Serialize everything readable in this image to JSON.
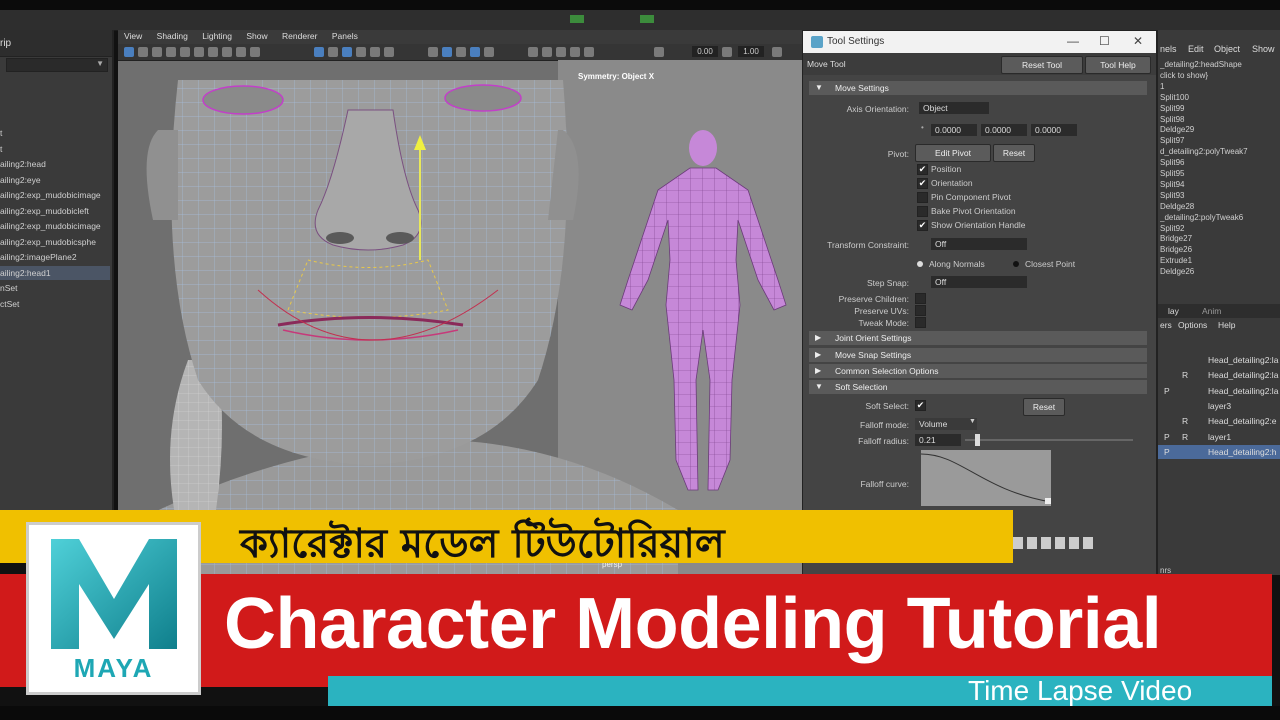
{
  "viewport": {
    "menu": [
      "View",
      "Shading",
      "Lighting",
      "Show",
      "Renderer",
      "Panels"
    ],
    "field_a": "0.00",
    "field_b": "1.00",
    "symmetry_label": "Symmetry: Object X",
    "camera_label": "persp"
  },
  "outliner": {
    "top_label": "rip",
    "items": [
      "t",
      "t",
      "ailing2:head",
      "ailing2:eye",
      "ailing2:exp_mudobicimage",
      "ailing2:exp_mudobicleft",
      "ailing2:exp_mudobicimage",
      "ailing2:exp_mudobicsphe",
      "ailing2:imagePlane2",
      "ailing2:head1",
      "nSet",
      "ctSet"
    ],
    "selected_index": 9
  },
  "tool_settings": {
    "window_title": "Tool Settings",
    "window_buttons": [
      "—",
      "☐",
      "✕"
    ],
    "tool_name": "Move Tool",
    "reset_tool": "Reset Tool",
    "tool_help": "Tool Help",
    "sections": {
      "move_settings": "Move Settings",
      "joint_orient": "Joint Orient Settings",
      "move_snap": "Move Snap Settings",
      "common_selection": "Common Selection Options",
      "soft_selection": "Soft Selection"
    },
    "axis_orientation_label": "Axis Orientation:",
    "axis_orientation_value": "Object",
    "axis_values": [
      "0.0000",
      "0.0000",
      "0.0000"
    ],
    "pivot_label": "Pivot:",
    "edit_pivot": "Edit Pivot",
    "reset": "Reset",
    "checks": [
      {
        "label": "Position",
        "checked": true
      },
      {
        "label": "Orientation",
        "checked": true
      },
      {
        "label": "Pin Component Pivot",
        "checked": false
      },
      {
        "label": "Bake Pivot Orientation",
        "checked": false
      },
      {
        "label": "Show Orientation Handle",
        "checked": true
      }
    ],
    "transform_constraint_label": "Transform Constraint:",
    "transform_constraint_value": "Off",
    "along_normals": "Along Normals",
    "closest_point": "Closest Point",
    "step_snap_label": "Step Snap:",
    "step_snap_value": "Off",
    "preserve_children": "Preserve Children:",
    "preserve_uvs": "Preserve UVs:",
    "tweak_mode": "Tweak Mode:",
    "soft_select_label": "Soft Select:",
    "soft_reset": "Reset",
    "falloff_mode_label": "Falloff mode:",
    "falloff_mode_value": "Volume",
    "falloff_radius_label": "Falloff radius:",
    "falloff_radius_value": "0.21",
    "falloff_curve_label": "Falloff curve:",
    "falloff_radius_fraction": 0.06
  },
  "right_panel": {
    "menu": [
      "nels",
      "Edit",
      "Object",
      "Show"
    ],
    "items": [
      "_detailing2:headShape",
      "click to show}",
      "1",
      "Split100",
      "Split99",
      "Split98",
      "Deldge29",
      "Split97",
      "d_detailing2:polyTweak7",
      "Split96",
      "Split95",
      "Split94",
      "Split93",
      "Deldge28",
      "_detailing2:polyTweak6",
      "Split92",
      "Bridge27",
      "Bridge26",
      "Extrude1",
      "Deldge26"
    ],
    "layers_tabs": [
      "lay",
      "Anim"
    ],
    "layer_menu": [
      "ers",
      "Options",
      "Help"
    ],
    "layers": [
      {
        "p": "",
        "r": "",
        "name": "Head_detailing2:la"
      },
      {
        "p": "",
        "r": "R",
        "name": "Head_detailing2:la"
      },
      {
        "p": "P",
        "r": "",
        "name": "Head_detailing2:la"
      },
      {
        "p": "",
        "r": "",
        "name": "layer3"
      },
      {
        "p": "",
        "r": "R",
        "name": "Head_detailing2:e"
      },
      {
        "p": "P",
        "r": "R",
        "name": "layer1"
      },
      {
        "p": "P",
        "r": "",
        "name": "Head_detailing2:h"
      }
    ],
    "selected_layer": 6,
    "bottom_label": "nrs"
  },
  "banner": {
    "bengali": "ক্যারেক্টার মডেল টিউটোরিয়াল",
    "title": "Character Modeling Tutorial",
    "subtitle": "Time Lapse Video",
    "logo_text": "MAYA",
    "colors": {
      "yellow": "#f0c000",
      "red": "#d11a1a",
      "teal": "#2bb3c0",
      "maya_teal": "#1ea7b4"
    }
  }
}
